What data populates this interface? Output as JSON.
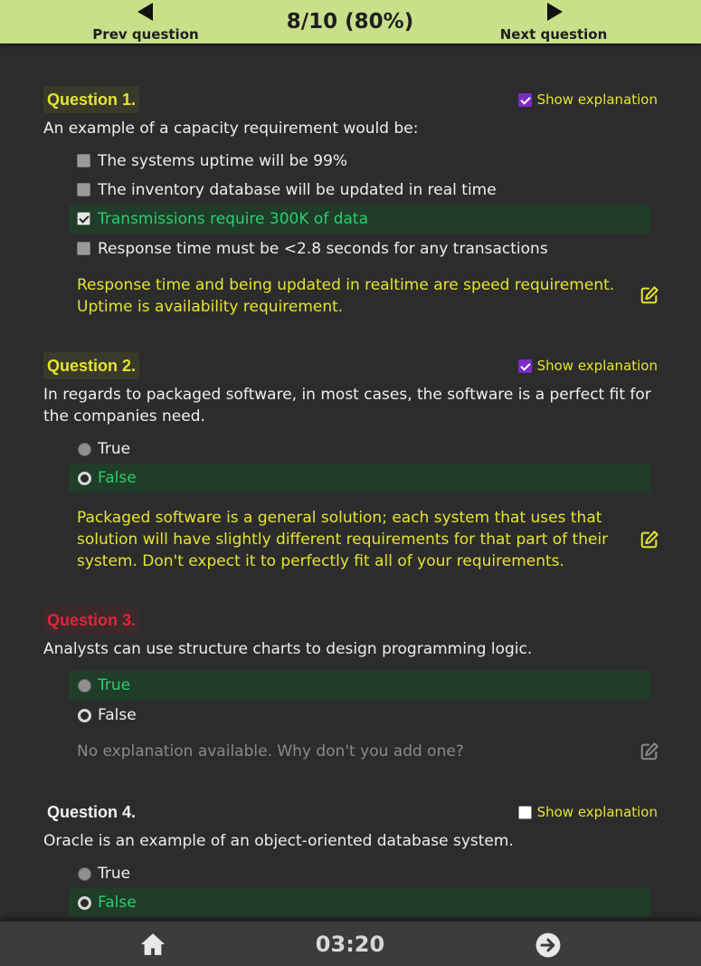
{
  "header": {
    "prev_label": "Prev question",
    "next_label": "Next question",
    "progress": "8/10 (80%)"
  },
  "show_explanation_label": "Show explanation",
  "questions": [
    {
      "title": "Question 1.",
      "status": "correct",
      "show_explanation": true,
      "text": "An example of a capacity requirement would be:",
      "type": "checkbox",
      "options": [
        {
          "label": "The systems uptime will be 99%",
          "checked": false,
          "highlighted": false
        },
        {
          "label": "The inventory database will be updated in real time",
          "checked": false,
          "highlighted": false
        },
        {
          "label": "Transmissions require 300K of data",
          "checked": true,
          "highlighted": true
        },
        {
          "label": "Response time must be <2.8 seconds for any transactions",
          "checked": false,
          "highlighted": false
        }
      ],
      "explanation": "Response time and being updated in realtime are speed requirement. Uptime is availability requirement."
    },
    {
      "title": "Question 2.",
      "status": "correct",
      "show_explanation": true,
      "text": "In regards to packaged software, in most cases, the software is a perfect fit for the companies need.",
      "type": "radio",
      "options": [
        {
          "label": "True",
          "checked": false,
          "highlighted": false
        },
        {
          "label": "False",
          "checked": true,
          "highlighted": true
        }
      ],
      "explanation": "Packaged software is a general solution; each system that uses that solution will have slightly different requirements for that part of their system. Don't expect it to perfectly fit all of your requirements."
    },
    {
      "title": "Question 3.",
      "status": "wrong",
      "show_explanation": false,
      "text": "Analysts can use structure charts to design programming logic.",
      "type": "radio",
      "options": [
        {
          "label": "True",
          "checked": false,
          "highlighted": true
        },
        {
          "label": "False",
          "checked": true,
          "highlighted": false
        }
      ],
      "explanation": "No explanation available. Why don't you add one?"
    },
    {
      "title": "Question 4.",
      "status": "plain",
      "show_explanation": false,
      "text": "Oracle is an example of an object-oriented database system.",
      "type": "radio",
      "options": [
        {
          "label": "True",
          "checked": false,
          "highlighted": false
        },
        {
          "label": "False",
          "checked": true,
          "highlighted": true
        }
      ]
    }
  ],
  "footer": {
    "timer": "03:20",
    "home_icon": "home-icon",
    "forward_icon": "arrow-circle-right-icon"
  },
  "colors": {
    "header_bg": "#c9e08a",
    "correct_title": "#e4e432",
    "wrong_title": "#e0243c",
    "highlight_bg": "#1f3d28",
    "highlight_text": "#2ecc71",
    "explanation_text": "#e4e432",
    "checkbox_accent": "#7b2cc4"
  }
}
